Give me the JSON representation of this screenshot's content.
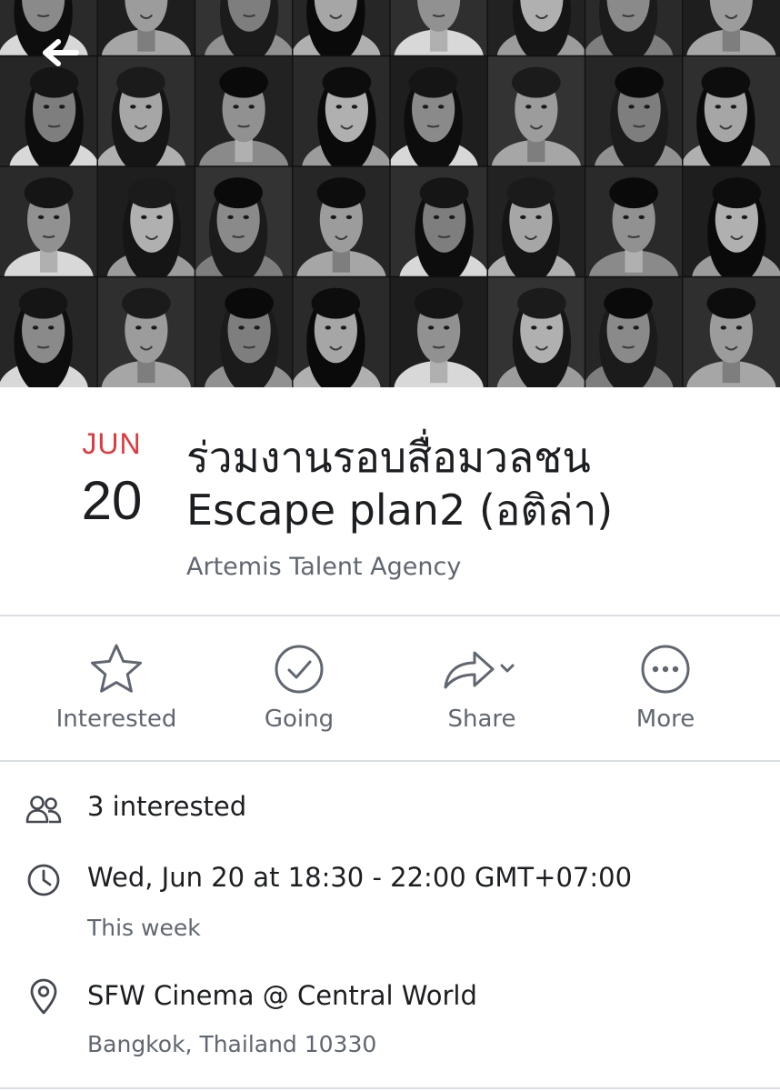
{
  "cover": {
    "alt": "cover photo",
    "nav_back_icon": "arrow-left-icon"
  },
  "event": {
    "month": "JUN",
    "day": "20",
    "title_line1": "ร่วมงานรอบสื่อมวลชน",
    "title_line2": "Escape plan2 (อติล่า)",
    "host": "Artemis Talent Agency"
  },
  "actions": [
    {
      "label": "Interested",
      "icon": "star-icon"
    },
    {
      "label": "Going",
      "icon": "check-circle-icon"
    },
    {
      "label": "Share",
      "icon": "share-arrow-icon"
    },
    {
      "label": "More",
      "icon": "more-dots-icon"
    }
  ],
  "details": {
    "interested": {
      "text": "3 interested",
      "icon": "people-icon"
    },
    "time": {
      "text": "Wed, Jun 20 at 18:30 - 22:00 GMT+07:00",
      "sub": "This week",
      "icon": "clock-icon"
    },
    "location": {
      "text": "SFW Cinema @ Central World",
      "sub": "Bangkok, Thailand 10330",
      "icon": "location-pin-icon"
    }
  },
  "colors": {
    "accent_red": "#e0393e",
    "text_primary": "#1c1e21",
    "text_secondary": "#606770",
    "divider": "#dadde1",
    "icon_gray": "#606770"
  }
}
